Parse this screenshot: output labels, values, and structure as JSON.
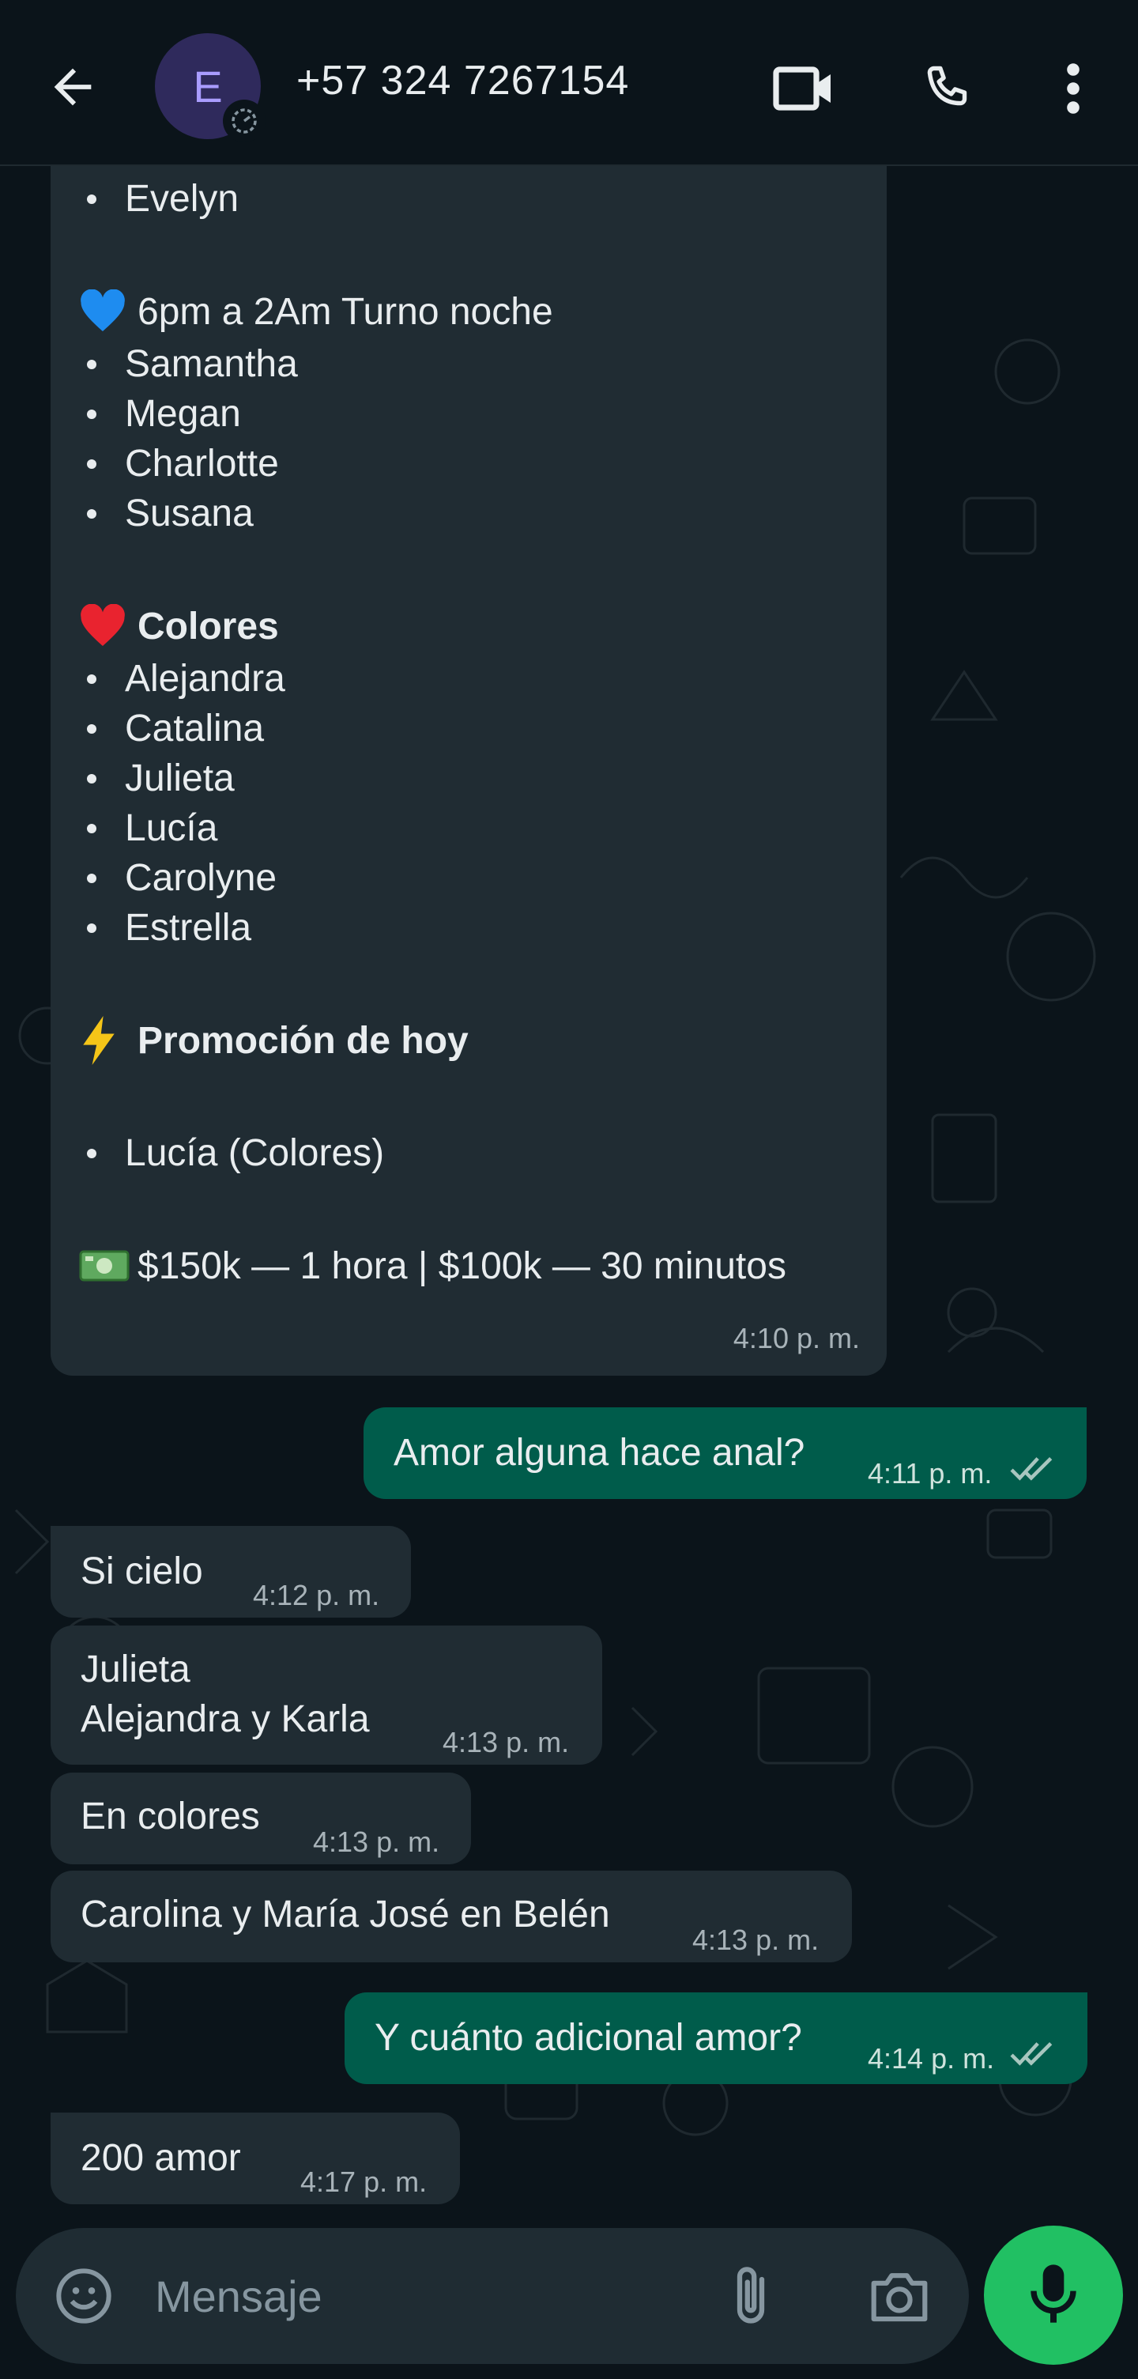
{
  "header": {
    "avatar_letter": "E",
    "title": "+57 324 7267154"
  },
  "list_message": {
    "first_item": "Evelyn",
    "night_heading": "6pm a 2Am Turno noche",
    "night_items": [
      "Samantha",
      "Megan",
      "Charlotte",
      "Susana"
    ],
    "colores_heading": "Colores",
    "colores_items": [
      "Alejandra",
      "Catalina",
      "Julieta",
      "Lucía",
      "Carolyne",
      "Estrella"
    ],
    "promo_heading": "Promoción de hoy",
    "promo_item": "Lucía (Colores)",
    "price_line": "$150k — 1 hora | $100k — 30 minutos",
    "time": "4:10 p. m."
  },
  "messages": [
    {
      "text": "Amor alguna hace anal?",
      "time": "4:11 p. m."
    },
    {
      "text": "Si cielo",
      "time": "4:12 p. m."
    },
    {
      "line1": "Julieta",
      "line2": "Alejandra y Karla",
      "time": "4:13 p. m."
    },
    {
      "text": "En colores",
      "time": "4:13 p. m."
    },
    {
      "text": "Carolina y María José en Belén",
      "time": "4:13 p. m."
    },
    {
      "text": "Y cuánto adicional amor?",
      "time": "4:14 p. m."
    },
    {
      "text": "200 amor",
      "time": "4:17 p. m."
    }
  ],
  "composer": {
    "placeholder": "Mensaje"
  },
  "icons": {
    "back": "back-arrow-icon",
    "video": "video-call-icon",
    "phone": "phone-icon",
    "menu": "more-vert-icon",
    "emoji": "emoji-icon",
    "attach": "attach-icon",
    "camera": "camera-icon",
    "mic": "mic-icon"
  },
  "colors": {
    "background": "#0b141a",
    "incoming_bubble": "#202c33",
    "outgoing_bubble": "#005c4b",
    "accent": "#21c063"
  }
}
